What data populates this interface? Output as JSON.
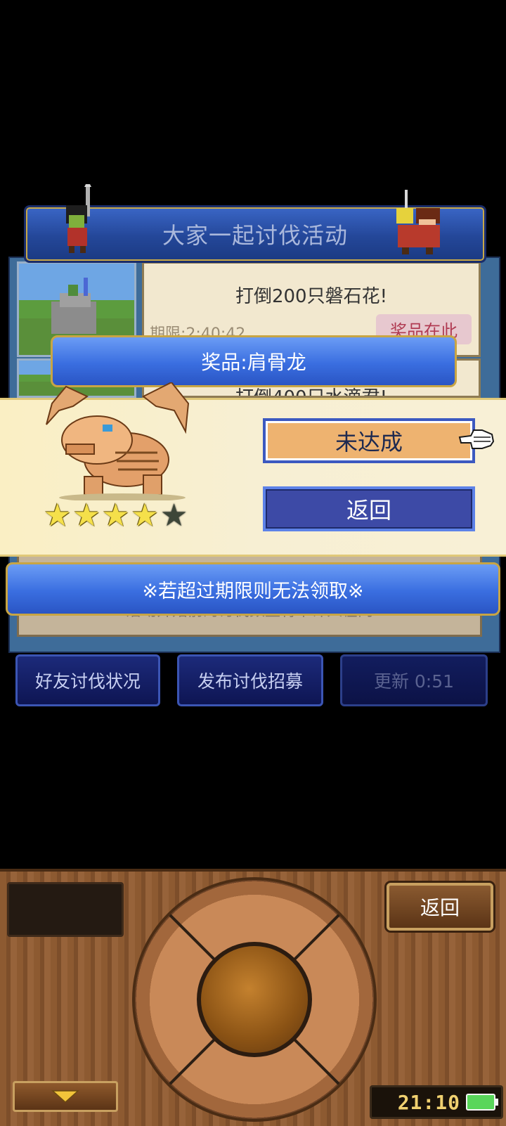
{
  "event": {
    "title": "大家一起讨伐活动",
    "quest1": {
      "text": "打倒200只磐石花!",
      "period": "期限:2:40:42",
      "status": "奖品在此"
    },
    "quest2_partial": "打倒400只水滴君!",
    "info_text": "活动开始前的讨伐数量将不计入在内",
    "tabs": {
      "friends": "好友讨伐状况",
      "recruit": "发布讨伐招募",
      "refresh": "更新 0:51"
    }
  },
  "popup": {
    "prize_label": "奖品:肩骨龙",
    "rating": 4,
    "rating_max": 5,
    "incomplete_label": "未达成",
    "return_label": "返回",
    "notice": "※若超过期限则无法领取※"
  },
  "controller": {
    "return_label": "返回",
    "clock": "21:10"
  },
  "colors": {
    "title_bar": "#244799",
    "prize_bar": "#3a6ee0",
    "incomplete_btn": "#eeb370",
    "return_btn": "#3d4aa6",
    "star_filled": "#f5e04a",
    "star_empty": "#3d4638"
  }
}
